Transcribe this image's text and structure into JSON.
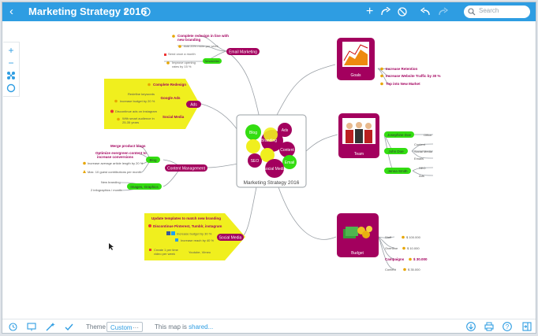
{
  "header": {
    "title": "Marketing Strategy 2016",
    "search_placeholder": "Search"
  },
  "icons": [
    "back-chevron-icon",
    "title-dropdown-icon",
    "info-icon",
    "add-icon",
    "redo-branch-icon",
    "block-icon",
    "undo-icon",
    "redo-icon",
    "search-icon",
    "zoom-in-icon",
    "zoom-out-icon",
    "arrange-icon",
    "center-icon",
    "history-icon",
    "presentation-icon",
    "magic-icon",
    "check-icon",
    "download-icon",
    "print-icon",
    "help-icon",
    "sidebar-icon"
  ],
  "colors": {
    "accent": "#2e9de2",
    "magenta": "#a3005e",
    "green": "#33dd11",
    "yellow": "#f0ef1e"
  },
  "bottom": {
    "theme_label": "Theme",
    "theme_value": "Custom",
    "theme_more": "···",
    "share_prefix": "This map is ",
    "share_link": "shared..."
  },
  "map": {
    "center": "Marketing Strategy 2016",
    "center_bubbles": [
      "Blog",
      "Ads",
      "Branding",
      "Content",
      "SEO",
      "Email",
      "Social Media"
    ],
    "email": {
      "label": "Email Marketing",
      "items": [
        "Complete redesign in line with",
        "new branding",
        "Add 20% more per week",
        "Send once a month",
        "Improve opening",
        "rates by 15 %"
      ],
      "sub": "Newsletter"
    },
    "goals": {
      "label": "Goals",
      "items": [
        "Increase Retention",
        "Increase Website Traffic by 30 %",
        "Top into New Market"
      ]
    },
    "ads": {
      "label": "Ads",
      "items": [
        "Complete Redesign",
        "Redefine keywords",
        "Increase budget by 20 %",
        "Discontinue ads on Instagram",
        "With smart audience in",
        "25-35 years"
      ],
      "subs": [
        "Google Ads",
        "Social Media"
      ]
    },
    "team": {
      "label": "Team",
      "members": [
        "Josephine Doe",
        "John Doe",
        "Jenna Smith"
      ],
      "roles": [
        "Office",
        "Content",
        "Social Media",
        "Emails",
        "SEO",
        "Ads"
      ]
    },
    "content": {
      "label": "Content Management",
      "blog": "Blog",
      "images": "Images, Graphics",
      "items": [
        "Merge product blogs",
        "Optimize evergreen content to",
        "increase conversions",
        "Increase average article length by 20 %",
        "Max. 10 guest contributions per month",
        "New branding",
        "2 infographics / month"
      ]
    },
    "social": {
      "label": "Social Media",
      "items": [
        "Update templates to match new branding",
        "Discontinue Pinterest, Tumblr, instagram",
        "Increase budget by 30 %",
        "Increase reach by 40 %",
        "Create 1 per time",
        "video per week",
        "Youtube, Vimeo"
      ]
    },
    "budget": {
      "label": "Budget",
      "items": [
        "Staff",
        "Overtime",
        "Campaigns",
        "Content"
      ],
      "values": [
        "$ 100.000",
        "$ 10.000",
        "$ 30.000",
        "$ 35.000"
      ]
    }
  }
}
